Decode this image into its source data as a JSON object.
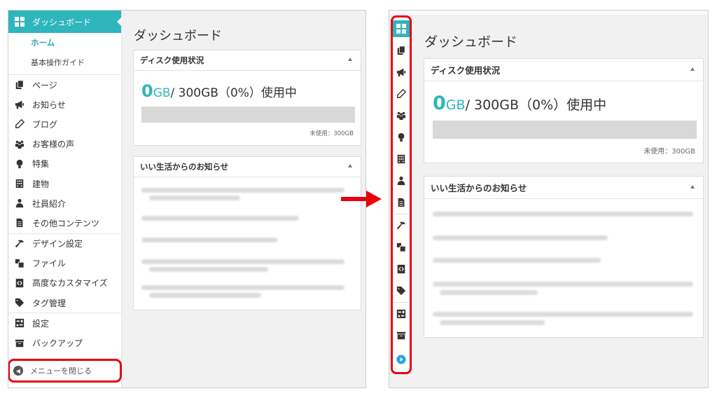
{
  "left": {
    "sidebar": {
      "active": "ダッシュボード",
      "sub": [
        "ホーム",
        "基本操作ガイド"
      ],
      "groups": [
        [
          {
            "label": "ページ",
            "icon": "pages-icon"
          },
          {
            "label": "お知らせ",
            "icon": "megaphone-icon"
          },
          {
            "label": "ブログ",
            "icon": "pencil-icon"
          },
          {
            "label": "お客様の声",
            "icon": "people-icon"
          },
          {
            "label": "特集",
            "icon": "lightbulb-icon"
          },
          {
            "label": "建物",
            "icon": "building-icon"
          },
          {
            "label": "社員紹介",
            "icon": "person-icon"
          },
          {
            "label": "その他コンテンツ",
            "icon": "document-icon"
          }
        ],
        [
          {
            "label": "デザイン設定",
            "icon": "hammer-icon"
          },
          {
            "label": "ファイル",
            "icon": "files-icon"
          },
          {
            "label": "高度なカスタマイズ",
            "icon": "code-file-icon"
          },
          {
            "label": "タグ管理",
            "icon": "tag-icon"
          }
        ],
        [
          {
            "label": "設定",
            "icon": "settings-icon"
          },
          {
            "label": "バックアップ",
            "icon": "archive-icon"
          }
        ]
      ],
      "collapse": "メニューを閉じる"
    }
  },
  "main": {
    "title": "ダッシュボード",
    "disk": {
      "heading": "ディスク使用状況",
      "used_num": "0",
      "used_unit": "GB",
      "rest": " / 300GB（0%）使用中",
      "usage_fraction": 0,
      "free": "未使用：300GB"
    },
    "news": {
      "heading": "いい生活からのお知らせ"
    }
  },
  "right": {
    "rail_icons": [
      "dashboard-icon",
      "pages-icon",
      "megaphone-icon",
      "pencil-icon",
      "people-icon",
      "lightbulb-icon",
      "building-icon",
      "person-icon",
      "document-icon",
      "hammer-icon",
      "files-icon",
      "code-file-icon",
      "tag-icon",
      "settings-icon",
      "archive-icon",
      "expand-menu-icon"
    ]
  },
  "colors": {
    "accent": "#2fb5bc",
    "highlight": "#e8000f"
  }
}
